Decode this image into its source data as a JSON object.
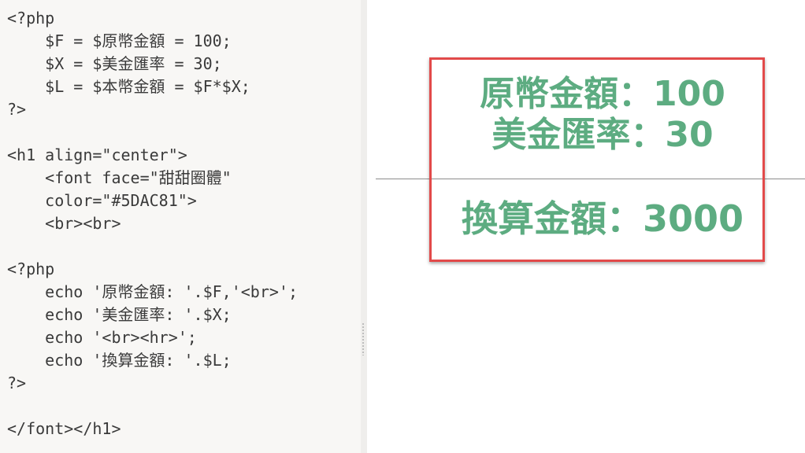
{
  "editor": {
    "code_lines": [
      "<?php",
      "    $F = $原幣金額 = 100;",
      "    $X = $美金匯率 = 30;",
      "    $L = $本幣金額 = $F*$X;",
      "?>",
      "",
      "<h1 align=\"center\">",
      "    <font face=\"甜甜圈體\"",
      "    color=\"#5DAC81\">",
      "    <br><br>",
      "",
      "<?php",
      "    echo '原幣金額: '.$F,'<br>';",
      "    echo '美金匯率: '.$X;",
      "    echo '<br><hr>';",
      "    echo '換算金額: '.$L;",
      "?>",
      "",
      "</font></h1>"
    ]
  },
  "preview": {
    "line1": "原幣金額：100",
    "line2": "美金匯率：30",
    "line3": "換算金額：3000",
    "text_color": "#5DAC81",
    "highlight_color": "#e24a4a"
  }
}
